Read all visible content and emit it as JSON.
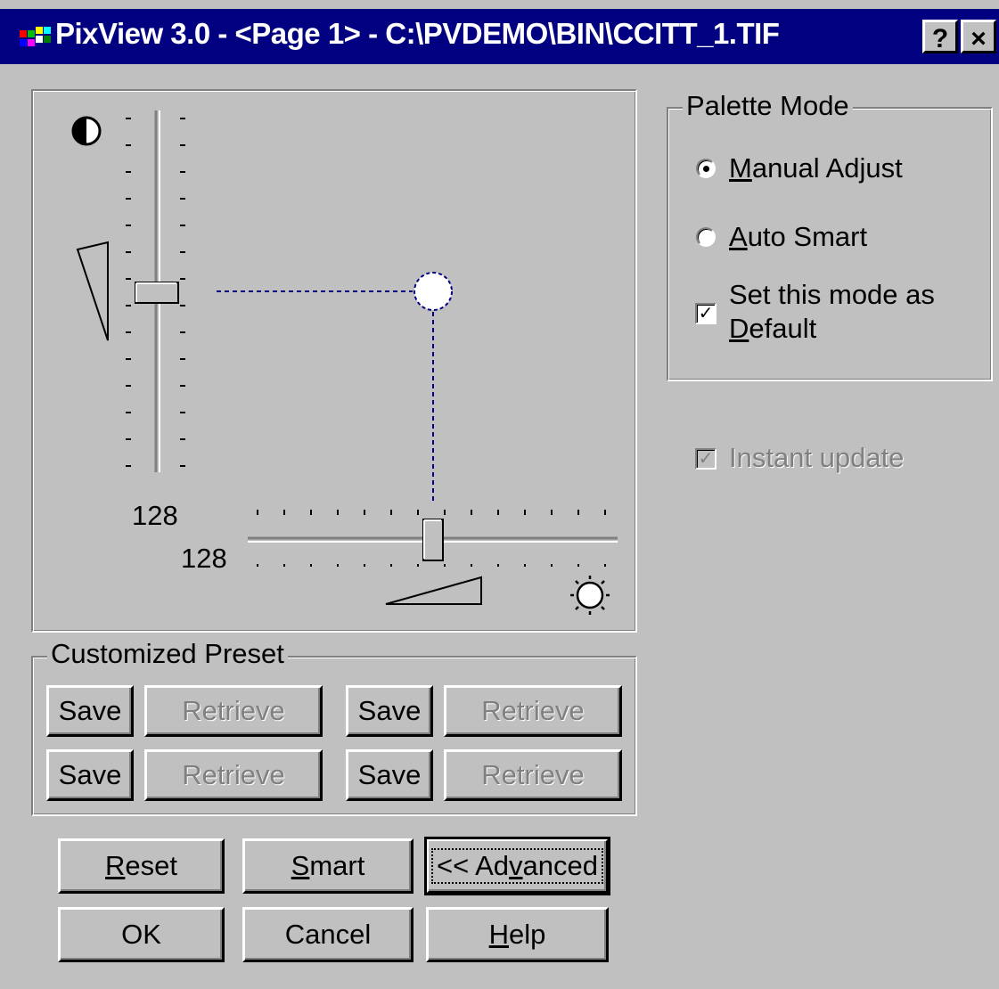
{
  "window": {
    "title": "PixView 3.0 - <Page 1> - C:\\PVDEMO\\BIN\\CCITT_1.TIF",
    "help_button": "?",
    "close_button": "×"
  },
  "adjust_panel": {
    "contrast_value": "128",
    "brightness_value": "128",
    "contrast_icon": "contrast-icon",
    "brightness_icon": "sun-icon",
    "contrast_level": 0.5,
    "brightness_level": 0.5
  },
  "palette_mode": {
    "legend": "Palette Mode",
    "options": [
      {
        "label": "Manual Adjust",
        "selected": true
      },
      {
        "label": "Auto Smart",
        "selected": false
      }
    ],
    "default_label_line1": "Set this mode as",
    "default_label_line2": "Default",
    "default_checked": true
  },
  "instant_update": {
    "label": "Instant update",
    "checked": true,
    "enabled": false
  },
  "preset": {
    "legend": "Customized Preset",
    "save_label": "Save",
    "retrieve_label": "Retrieve"
  },
  "buttons": {
    "reset": "Reset",
    "smart": "Smart",
    "advanced": "<< Advanced",
    "ok": "OK",
    "cancel": "Cancel",
    "help": "Help"
  }
}
